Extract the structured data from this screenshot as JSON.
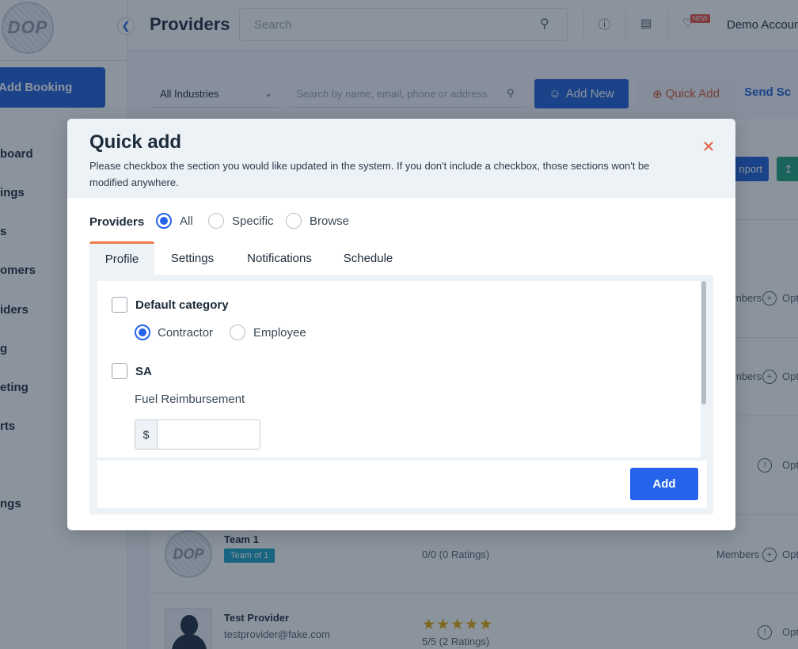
{
  "app": {
    "logo_text": "DOP",
    "add_booking_label": "Add Booking",
    "nav_items": [
      "board",
      "ings",
      "s",
      "omers",
      "iders",
      "g",
      "eting",
      "rts",
      "ngs"
    ],
    "page_title": "Providers",
    "search_placeholder": "Search",
    "notification_badge": "NEW",
    "account_name": "Demo Accoun"
  },
  "toolbar": {
    "industry_filter": "All Industries",
    "filter_search_placeholder": "Search by name, email, phone or address",
    "add_new_label": "Add New",
    "quick_add_label": "Quick Add",
    "send_label": "Send Sc",
    "import_label": "nport"
  },
  "rows": [
    {
      "members_label": "mbers",
      "options_label": "Opt"
    },
    {
      "members_label": "mbers",
      "options_label": "Opt"
    },
    {
      "options_label": "Opt"
    },
    {
      "name": "Team 1",
      "chip": "Team of 1",
      "ratings": "0/0 (0 Ratings)",
      "members_label": "Members",
      "options_label": "Opt"
    },
    {
      "name": "Test Provider",
      "email": "testprovider@fake.com",
      "ratings": "5/5  (2 Ratings)",
      "stars": "★★★★★",
      "options_label": "Opt"
    }
  ],
  "modal": {
    "title": "Quick add",
    "description": "Please checkbox the section you would like updated in the system. If you don't include a checkbox, those sections won't be modified anywhere.",
    "providers_label": "Providers",
    "provider_scope": {
      "options": [
        "All",
        "Specific",
        "Browse"
      ],
      "selected": "All"
    },
    "tabs": [
      "Profile",
      "Settings",
      "Notifications",
      "Schedule"
    ],
    "active_tab": "Profile",
    "sections": {
      "default_category": {
        "label": "Default category",
        "checked": false,
        "options": [
          "Contractor",
          "Employee"
        ],
        "selected": "Contractor"
      },
      "sa": {
        "label": "SA",
        "checked": false,
        "fuel_label": "Fuel Reimbursement",
        "currency_symbol": "$",
        "fuel_value": ""
      }
    },
    "submit_label": "Add"
  },
  "colors": {
    "primary": "#2563eb",
    "accent_orange": "#f07a4a",
    "close": "#e0603f",
    "header_bg": "#edf2f7"
  }
}
